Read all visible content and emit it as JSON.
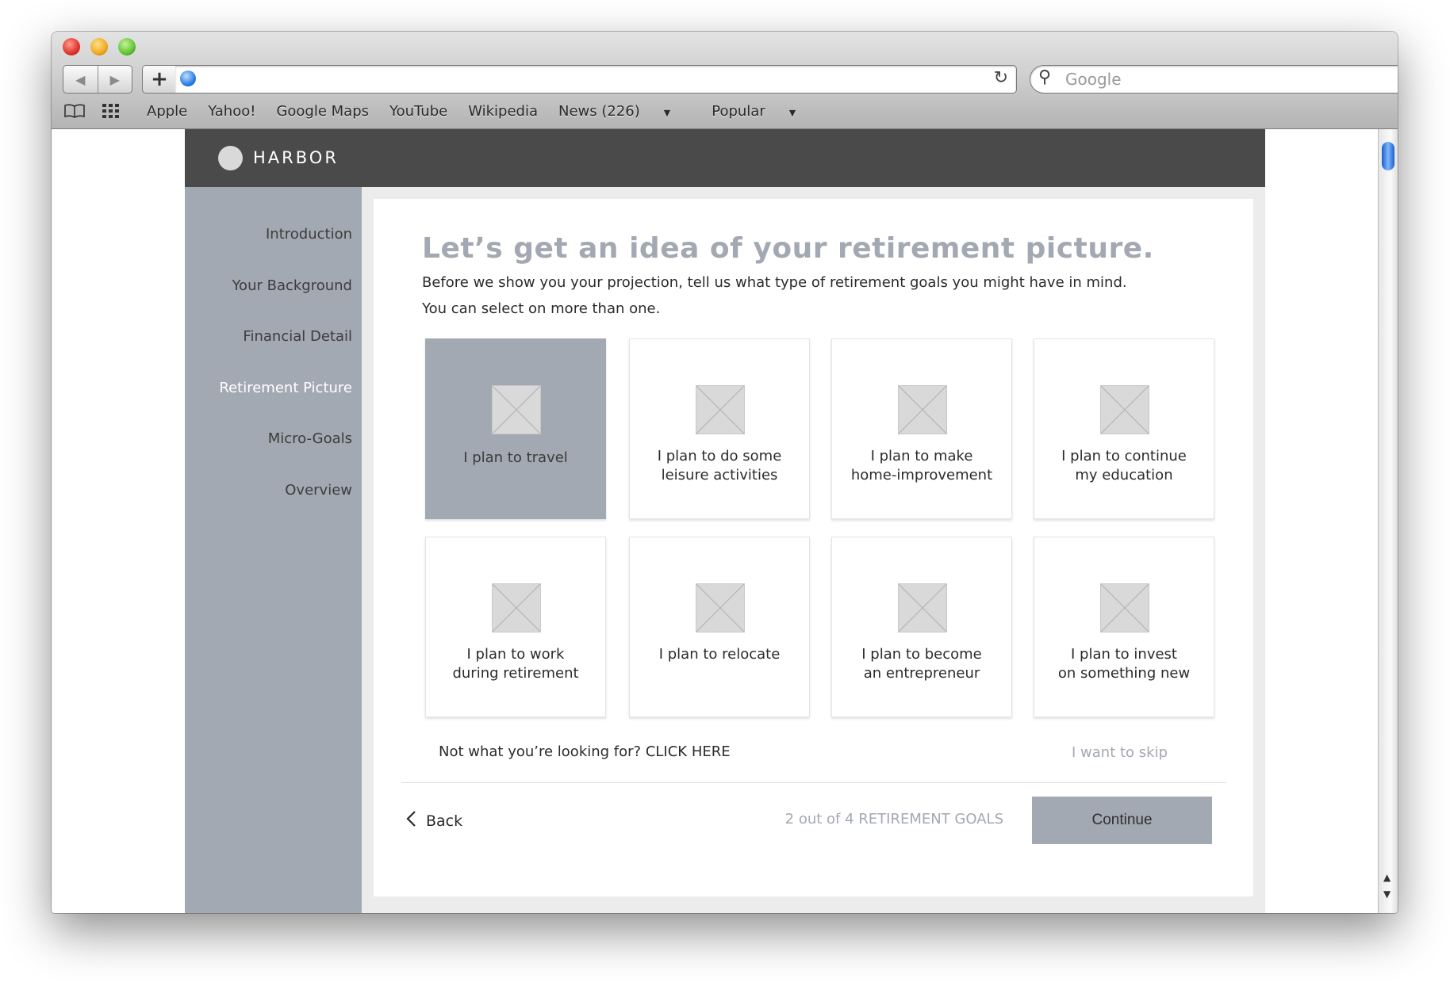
{
  "browser": {
    "bookmarks": [
      "Apple",
      "Yahoo!",
      "Google Maps",
      "YouTube",
      "Wikipedia"
    ],
    "bookmark_news": "News (226)",
    "bookmark_popular": "Popular",
    "search_placeholder": "Google"
  },
  "app": {
    "brand": "HARBOR",
    "sidebar": {
      "items": [
        "Introduction",
        "Your Background",
        "Financial Detail",
        "Retirement Picture",
        "Micro-Goals",
        "Overview"
      ],
      "active_index": 3
    },
    "main": {
      "title": "Let’s get an idea of your retirement picture.",
      "subtitle_1": "Before we show you your projection, tell us what type of retirement goals you might have in mind.",
      "subtitle_2": "You can select on more than one.",
      "goals": [
        {
          "label": "I plan to travel",
          "selected": true
        },
        {
          "label": "I plan to do some\nleisure activities",
          "selected": false
        },
        {
          "label": "I plan to make\nhome-improvement",
          "selected": false
        },
        {
          "label": "I plan to continue\nmy education",
          "selected": false
        },
        {
          "label": "I plan to work\nduring retirement",
          "selected": false
        },
        {
          "label": "I plan to relocate",
          "selected": false
        },
        {
          "label": "I plan to become\nan entrepreneur",
          "selected": false
        },
        {
          "label": "I plan to invest\non something new",
          "selected": false
        }
      ],
      "not_looking": "Not what you’re looking for? CLICK HERE",
      "skip": "I want to skip",
      "back": "Back",
      "progress": "2 out of 4 RETIREMENT GOALS",
      "continue": "Continue"
    },
    "colors": {
      "accent": "#a3a9b2",
      "header": "#4a4a4a"
    }
  }
}
